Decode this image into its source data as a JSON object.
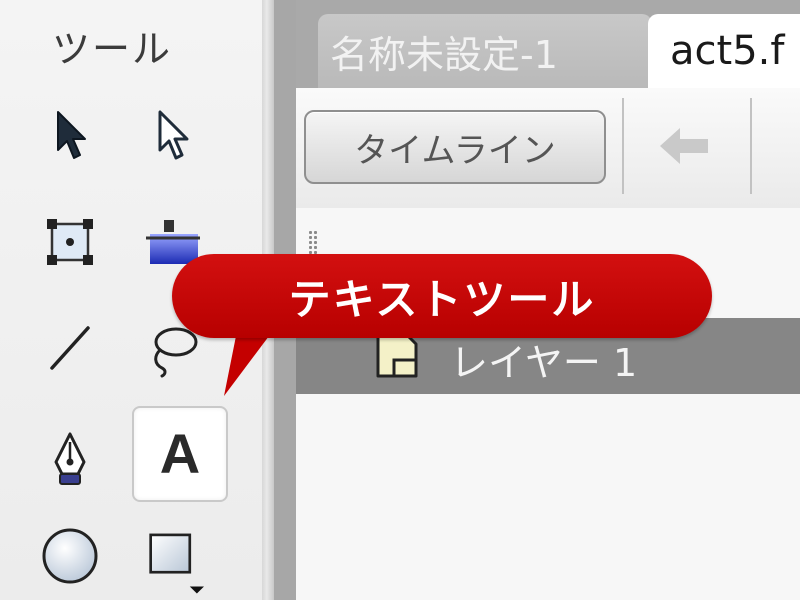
{
  "tools_panel": {
    "title": "ツール",
    "tools": [
      {
        "name": "selection-tool",
        "icon": "arrow-black-icon"
      },
      {
        "name": "subselection-tool",
        "icon": "arrow-white-icon"
      },
      {
        "name": "free-transform-tool",
        "icon": "transform-box-icon"
      },
      {
        "name": "gradient-transform-tool",
        "icon": "gradient-transform-icon"
      },
      {
        "name": "line-tool",
        "icon": "line-icon"
      },
      {
        "name": "lasso-tool",
        "icon": "lasso-icon"
      },
      {
        "name": "pen-tool",
        "icon": "pen-nib-icon"
      },
      {
        "name": "text-tool",
        "icon": "text-A-icon",
        "label": "A",
        "active": true
      },
      {
        "name": "oval-tool",
        "icon": "circle-icon"
      },
      {
        "name": "rectangle-tool",
        "icon": "rectangle-icon"
      }
    ]
  },
  "tabs": [
    {
      "label": "名称未設定-1",
      "active": false
    },
    {
      "label": "act5.f",
      "active": true
    }
  ],
  "toolbar": {
    "timeline_label": "タイムライン",
    "back_icon": "back-arrow-icon"
  },
  "timeline": {
    "layers": [
      {
        "name": "レイヤー 1",
        "icon": "layer-page-icon"
      }
    ]
  },
  "callout": {
    "text": "テキストツール",
    "color": "#c40000"
  },
  "colors": {
    "panel_bg": "#f0f0f0",
    "tab_strip": "#a9a9a9",
    "layer_row": "#868686",
    "callout_red": "#c40000"
  }
}
